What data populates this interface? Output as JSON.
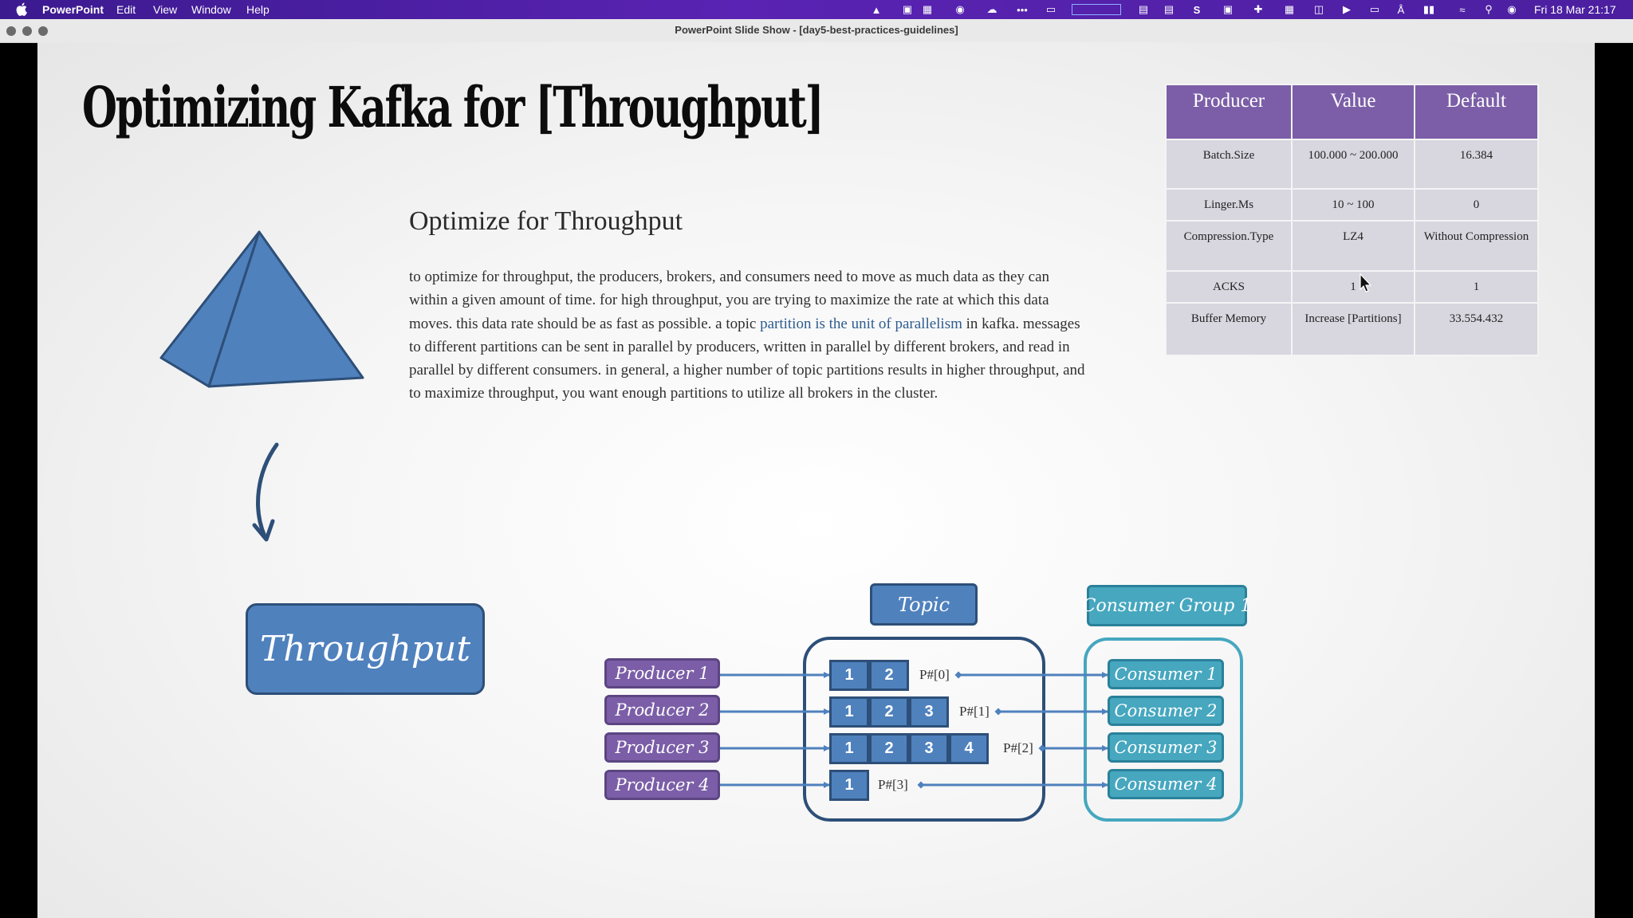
{
  "menubar": {
    "app_name": "PowerPoint",
    "menus": [
      "Edit",
      "View",
      "Window",
      "Help"
    ],
    "clock": "Fri 18 Mar  21:17"
  },
  "window": {
    "title": "PowerPoint Slide Show - [day5-best-practices-guidelines]"
  },
  "slide": {
    "title": "Optimizing Kafka for [Throughput]",
    "subtitle": "Optimize for Throughput",
    "body": {
      "before_link": "to optimize for throughput, the producers, brokers, and consumers need to move as much data as they can within a given amount of time. for high throughput, you are trying to maximize the rate at which this data moves. this data rate should be as fast as possible. a topic ",
      "link": "partition is the unit of parallelism",
      "after_link": " in kafka. messages to different partitions can be sent in parallel by producers, written in parallel by different brokers, and read in parallel by different consumers. in general, a higher number of topic partitions results in higher throughput, and to maximize throughput, you want enough partitions to utilize all brokers in the cluster."
    },
    "table": {
      "headers": [
        "Producer",
        "Value",
        "Default"
      ],
      "rows": [
        [
          "Batch.Size",
          "100.000 ~ 200.000",
          "16.384"
        ],
        [
          "Linger.Ms",
          "10 ~ 100",
          "0"
        ],
        [
          "Compression.Type",
          "LZ4",
          "Without Compression"
        ],
        [
          "ACKS",
          "1",
          "1"
        ],
        [
          "Buffer Memory",
          "Increase [Partitions]",
          "33.554.432"
        ]
      ]
    },
    "throughput_label": "Throughput",
    "diagram": {
      "topic_label": "Topic",
      "group_label": "Consumer Group 1",
      "producers": [
        "Producer 1",
        "Producer 2",
        "Producer 3",
        "Producer 4"
      ],
      "consumers": [
        "Consumer 1",
        "Consumer 2",
        "Consumer 3",
        "Consumer 4"
      ],
      "partitions": [
        {
          "label": "P#[0]",
          "cells": [
            "1",
            "2"
          ]
        },
        {
          "label": "P#[1]",
          "cells": [
            "1",
            "2",
            "3"
          ]
        },
        {
          "label": "P#[2]",
          "cells": [
            "1",
            "2",
            "3",
            "4"
          ]
        },
        {
          "label": "P#[3]",
          "cells": [
            "1"
          ]
        }
      ]
    }
  },
  "colors": {
    "menubar": "#4b1fa0",
    "producer": "#7b5ea7",
    "topic_blue": "#4f81bd",
    "consumer": "#46a7bf",
    "table_header": "#7b5ea7",
    "table_cell": "#d8d6df"
  }
}
